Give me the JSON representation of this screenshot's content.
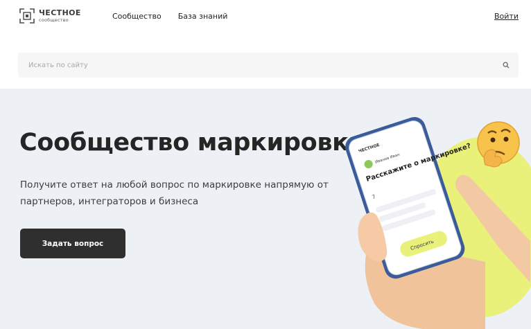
{
  "header": {
    "logo_line1": "ЧЕСТНОЕ",
    "logo_line2": "сообщество",
    "nav": [
      "Сообщество",
      "База знаний"
    ],
    "login": "Войти"
  },
  "search": {
    "placeholder": "Искать по сайту",
    "icon": "search-icon"
  },
  "hero": {
    "title": "Сообщество маркировки",
    "subtitle": "Получите ответ на любой вопрос по маркировке напрямую от партнеров, интеграторов и бизнеса",
    "cta": "Задать вопрос"
  },
  "phone": {
    "logo": "ЧЕСТНОЕ",
    "user_name": "Иванов Иван",
    "question": "Расскажите о маркировке?",
    "likes": "7",
    "button": "Спросить"
  },
  "colors": {
    "hero_bg": "#edf0f5",
    "accent_yellow": "#e9f17a",
    "button_dark": "#2f2f2f"
  }
}
